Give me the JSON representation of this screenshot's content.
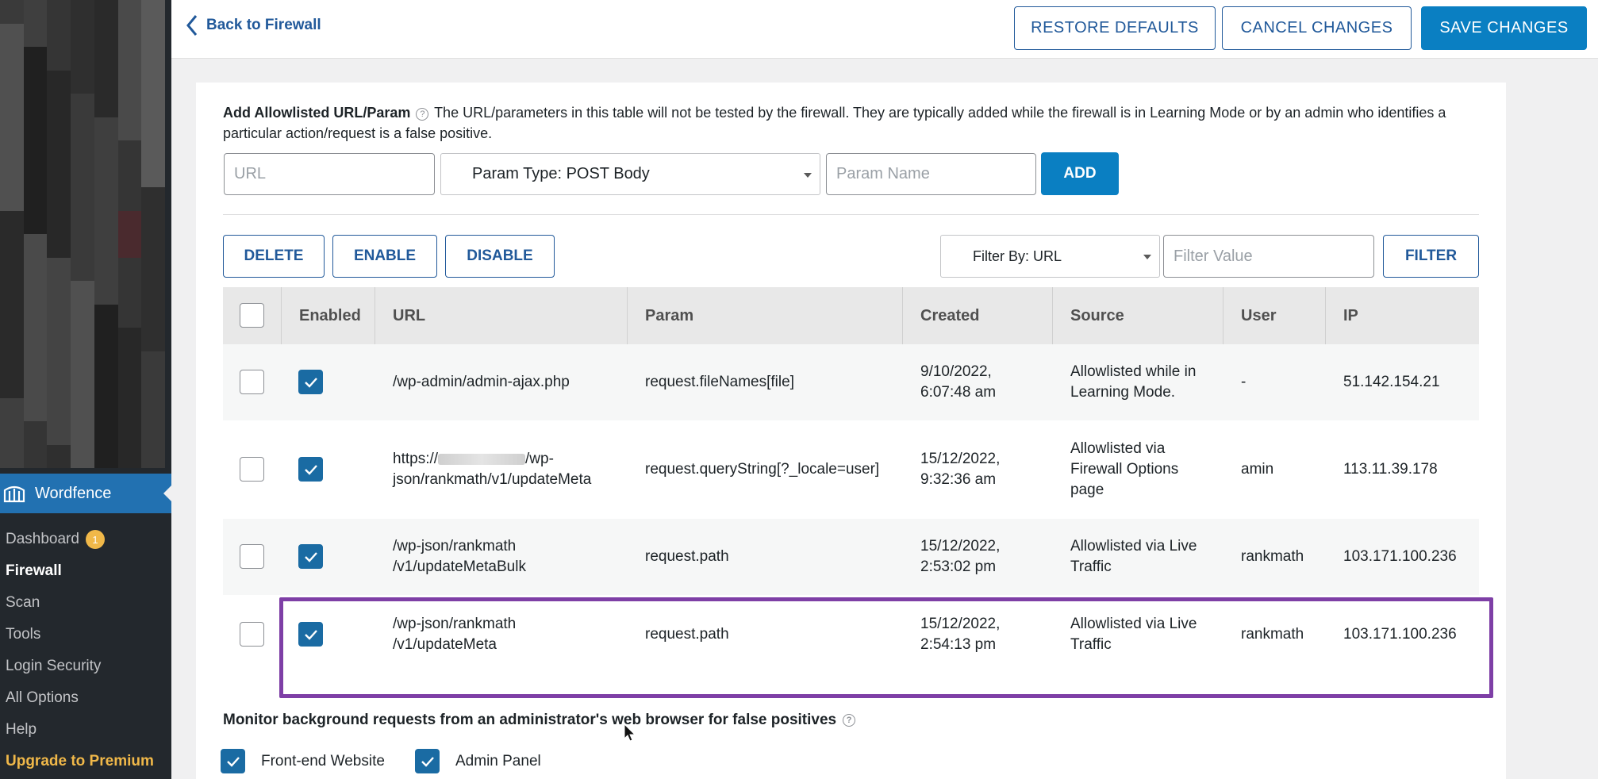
{
  "sidebar": {
    "plugin_name": "Wordfence",
    "items": [
      {
        "label": "Dashboard",
        "badge": "1"
      },
      {
        "label": "Firewall"
      },
      {
        "label": "Scan"
      },
      {
        "label": "Tools"
      },
      {
        "label": "Login Security"
      },
      {
        "label": "All Options"
      },
      {
        "label": "Help"
      },
      {
        "label": "Upgrade to Premium"
      }
    ]
  },
  "topbar": {
    "back_label": "Back to Firewall",
    "restore_label": "RESTORE DEFAULTS",
    "cancel_label": "CANCEL CHANGES",
    "save_label": "SAVE CHANGES"
  },
  "allowlist": {
    "title": "Add Allowlisted URL/Param",
    "description": " The URL/parameters in this table will not be tested by the firewall. They are typically added while the firewall is in Learning Mode or by an admin who identifies a particular action/request is a false positive.",
    "url_placeholder": "URL",
    "param_type_selected": "Param Type: POST Body",
    "param_name_placeholder": "Param Name",
    "add_label": "ADD"
  },
  "actions": {
    "delete_label": "DELETE",
    "enable_label": "ENABLE",
    "disable_label": "DISABLE",
    "filter_by_selected": "Filter By: URL",
    "filter_value_placeholder": "Filter Value",
    "filter_label": "FILTER"
  },
  "table": {
    "headers": [
      "Enabled",
      "URL",
      "Param",
      "Created",
      "Source",
      "User",
      "IP"
    ],
    "rows": [
      {
        "url1": "/wp-admin/admin-ajax.php",
        "url2": "",
        "param": "request.fileNames[file]",
        "created1": "9/10/2022,",
        "created2": "6:07:48 am",
        "source1": "Allowlisted while in",
        "source2": "Learning Mode.",
        "source3": "",
        "user": "-",
        "ip": "51.142.154.21",
        "enabled": true
      },
      {
        "url1": "https://",
        "url1b": "/wp-",
        "url2": "json/rankmath/v1/updateMeta",
        "param": "request.queryString[?_locale=user]",
        "created1": "15/12/2022,",
        "created2": "9:32:36 am",
        "source1": "Allowlisted via",
        "source2": "Firewall Options",
        "source3": "page",
        "user": "amin",
        "ip": "113.11.39.178",
        "enabled": true
      },
      {
        "url1": "/wp-json/rankmath",
        "url2": "/v1/updateMetaBulk",
        "param": "request.path",
        "created1": "15/12/2022,",
        "created2": "2:53:02 pm",
        "source1": "Allowlisted via Live",
        "source2": "Traffic",
        "source3": "",
        "user": "rankmath",
        "ip": "103.171.100.236",
        "enabled": true
      },
      {
        "url1": "/wp-json/rankmath",
        "url2": "/v1/updateMeta",
        "param": "request.path",
        "created1": "15/12/2022,",
        "created2": "2:54:13 pm",
        "source1": "Allowlisted via Live",
        "source2": "Traffic",
        "source3": "",
        "user": "rankmath",
        "ip": "103.171.100.236",
        "enabled": true
      }
    ]
  },
  "monitor": {
    "title": "Monitor background requests from an administrator's web browser for false positives",
    "option1": "Front-end Website",
    "option2": "Admin Panel"
  },
  "colors": {
    "accent": "#0a7fc2",
    "link": "#21599a",
    "sidebar_bg": "#23282d",
    "active_menu": "#2271b1",
    "premium": "#f0b849",
    "highlight": "#7e3fa6"
  }
}
